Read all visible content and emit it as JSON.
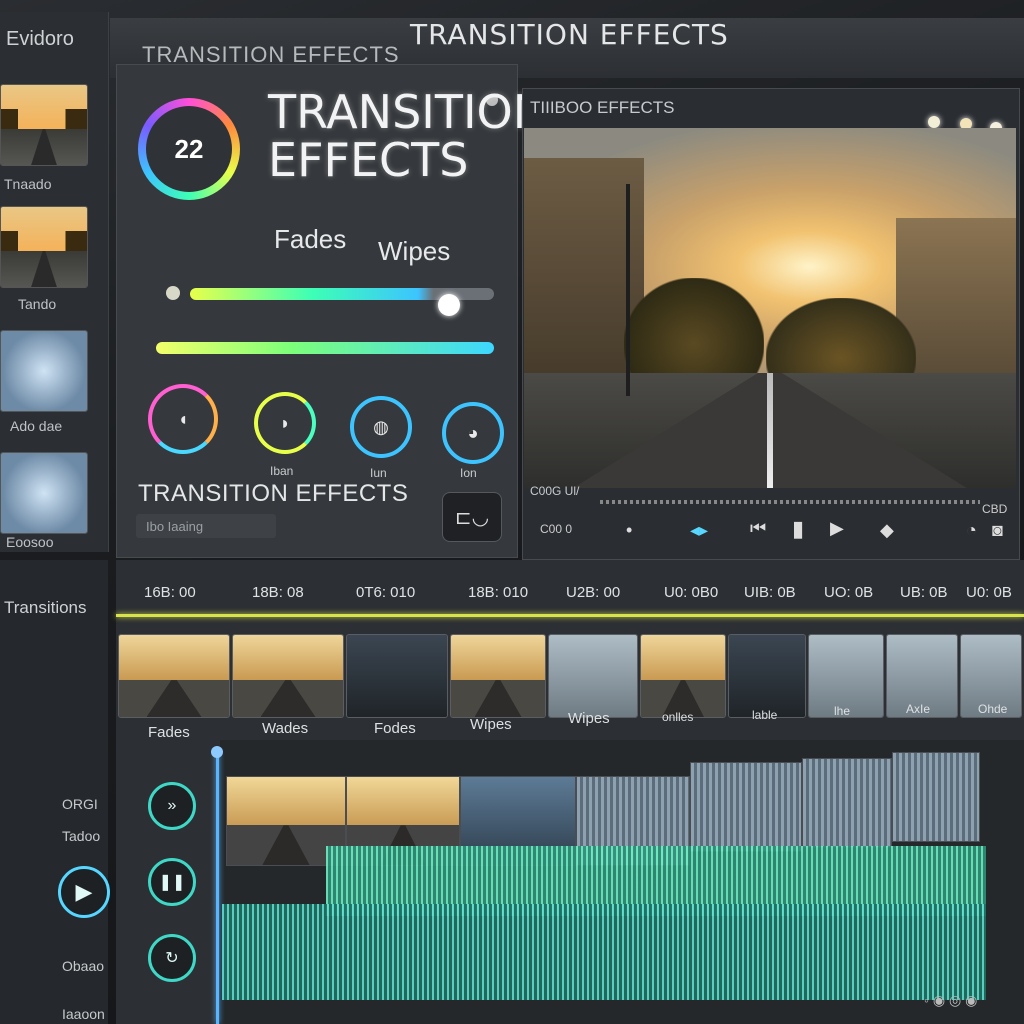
{
  "window": {
    "title": "TRANSITION EFFECTS"
  },
  "sidebar": {
    "brand": "Evidoro",
    "items": [
      {
        "label": "Tnaado"
      },
      {
        "label": "Tando"
      },
      {
        "label": "Ado dae"
      },
      {
        "label": "Eoosoo"
      }
    ],
    "section_label": "Transitions"
  },
  "effects_panel": {
    "header": "TRANSITION EFFECTS",
    "badge": "22",
    "title_line1": "TRANSITION",
    "title_line2": "EFFECTS",
    "option_fades": "Fades",
    "option_wipes": "Wipes",
    "rings": [
      {
        "label": ""
      },
      {
        "label": "Iban"
      },
      {
        "label": "Iun"
      },
      {
        "label": "Ion"
      }
    ],
    "footer_label": "TRANSITION EFFECTS",
    "field_value": "Ibo  Iaaing"
  },
  "preview": {
    "header": "TIIIBOO EFFECTS",
    "scrub_time": "C00G  Ul/",
    "scrub_end": "CBD",
    "controls_time": "C00 0",
    "mini": "ⓢ ⓞ ▭"
  },
  "timeline": {
    "ruler": [
      "16B: 00",
      "18B: 08",
      "0T6: 010",
      "18B: 010",
      "U2B: 00",
      "U0: 0B0",
      "UIB: 0B",
      "UO: 0B",
      "UB: 0B",
      "U0: 0B"
    ],
    "strip_labels": [
      "Fades",
      "Wades",
      "Fodes",
      "Wipes",
      "Wipes",
      "onlles",
      "lable",
      "lhe",
      "AxIe",
      "Ohde"
    ],
    "side_labels": [
      "ORGI",
      "Tadoo",
      "Obaao",
      "Iaaoon"
    ]
  },
  "colors": {
    "accent": "#3fd8c7",
    "playhead": "#57b6ff",
    "marker": "#d9e34a"
  }
}
